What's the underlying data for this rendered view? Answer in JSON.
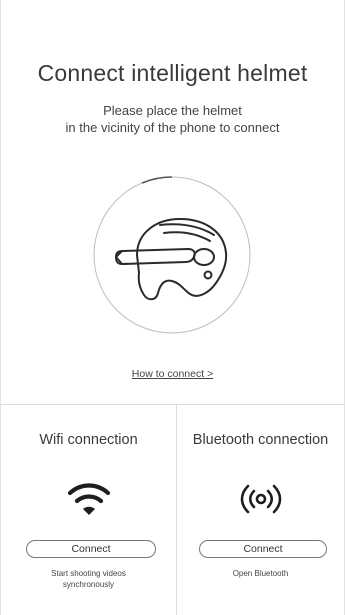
{
  "header": {
    "title": "Connect intelligent helmet",
    "subtitle_line1": "Please place the helmet",
    "subtitle_line2": "in the vicinity of the phone to connect"
  },
  "illustration": {
    "icon": "helmet-icon"
  },
  "how_to_link": "How to connect >",
  "wifi": {
    "title": "Wifi connection",
    "icon": "wifi-icon",
    "button_label": "Connect",
    "desc_line1": "Start shooting videos",
    "desc_line2": "synchronously"
  },
  "bluetooth": {
    "title": "Bluetooth connection",
    "icon": "bluetooth-signal-icon",
    "button_label": "Connect",
    "desc_line1": "Open Bluetooth"
  },
  "colors": {
    "text": "#333333",
    "divider": "#dddddd",
    "icon": "#222222"
  }
}
